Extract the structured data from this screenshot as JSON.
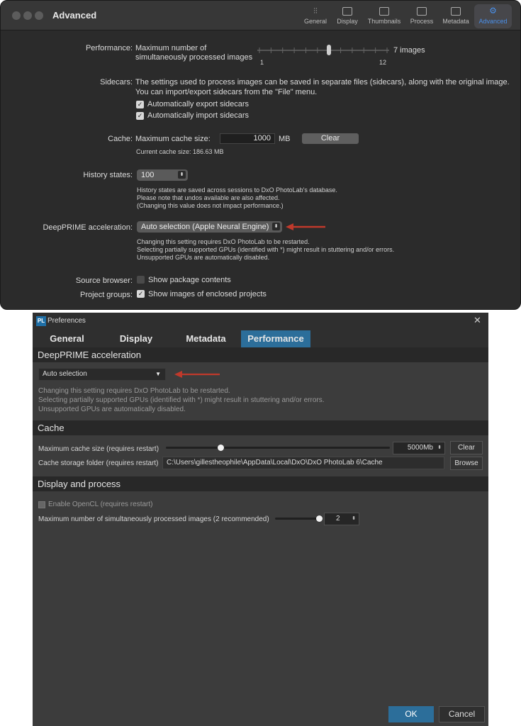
{
  "mac": {
    "title": "Advanced",
    "toolbar": [
      "General",
      "Display",
      "Thumbnails",
      "Process",
      "Metadata",
      "Advanced"
    ],
    "performance": {
      "label": "Performance:",
      "desc_line1": "Maximum number of",
      "desc_line2": "simultaneously processed images",
      "value_text": "7 images",
      "min": "1",
      "max": "12",
      "value": 7
    },
    "sidecars": {
      "label": "Sidecars:",
      "desc_line1": "The settings used to process images can be saved in separate files (sidecars), along with the original image.",
      "desc_line2": "You can import/export sidecars from the \"File\" menu.",
      "export_label": "Automatically export sidecars",
      "import_label": "Automatically import sidecars"
    },
    "cache": {
      "label": "Cache:",
      "field_label": "Maximum cache size:",
      "value": "1000",
      "unit": "MB",
      "clear": "Clear",
      "current": "Current cache size: 186.63 MB"
    },
    "history": {
      "label": "History states:",
      "value": "100",
      "note1": "History states are saved across sessions to DxO PhotoLab's database.",
      "note2": "Please note that undos available are also affected.",
      "note3": "(Changing this value does not impact performance.)"
    },
    "deepprime": {
      "label": "DeepPRIME acceleration:",
      "value": "Auto selection (Apple Neural Engine)",
      "note1": "Changing this setting requires DxO PhotoLab to be restarted.",
      "note2": "Selecting partially supported GPUs (identified with *) might result in stuttering and/or errors.",
      "note3": "Unsupported GPUs are automatically disabled."
    },
    "source_browser": {
      "label": "Source browser:",
      "option": "Show package contents"
    },
    "project_groups": {
      "label": "Project groups:",
      "option": "Show images of enclosed projects"
    }
  },
  "win": {
    "title": "Preferences",
    "app_icon": "PL",
    "tabs": [
      "General",
      "Display",
      "Metadata",
      "Performance"
    ],
    "deepprime": {
      "header": "DeepPRIME acceleration",
      "value": "Auto selection",
      "note1": "Changing this setting requires DxO PhotoLab to be restarted.",
      "note2": "Selecting partially supported GPUs (identified with *) might result in stuttering and/or errors.",
      "note3": "Unsupported GPUs are automatically disabled."
    },
    "cache": {
      "header": "Cache",
      "size_label": "Maximum cache size (requires restart)",
      "size_value": "5000Mb",
      "clear": "Clear",
      "folder_label": "Cache storage folder (requires restart)",
      "folder_path": "C:\\Users\\gillestheophile\\AppData\\Local\\DxO\\DxO PhotoLab 6\\Cache",
      "browse": "Browse"
    },
    "display": {
      "header": "Display and process",
      "opencl_label": "Enable OpenCL (requires restart)",
      "images_label": "Maximum number of simultaneously processed images (2 recommended)",
      "images_value": "2"
    },
    "ok": "OK",
    "cancel": "Cancel"
  },
  "colors": {
    "arrow": "#c0392b",
    "accent_mac": "#4a8fe8",
    "accent_win": "#2c6e9a"
  }
}
